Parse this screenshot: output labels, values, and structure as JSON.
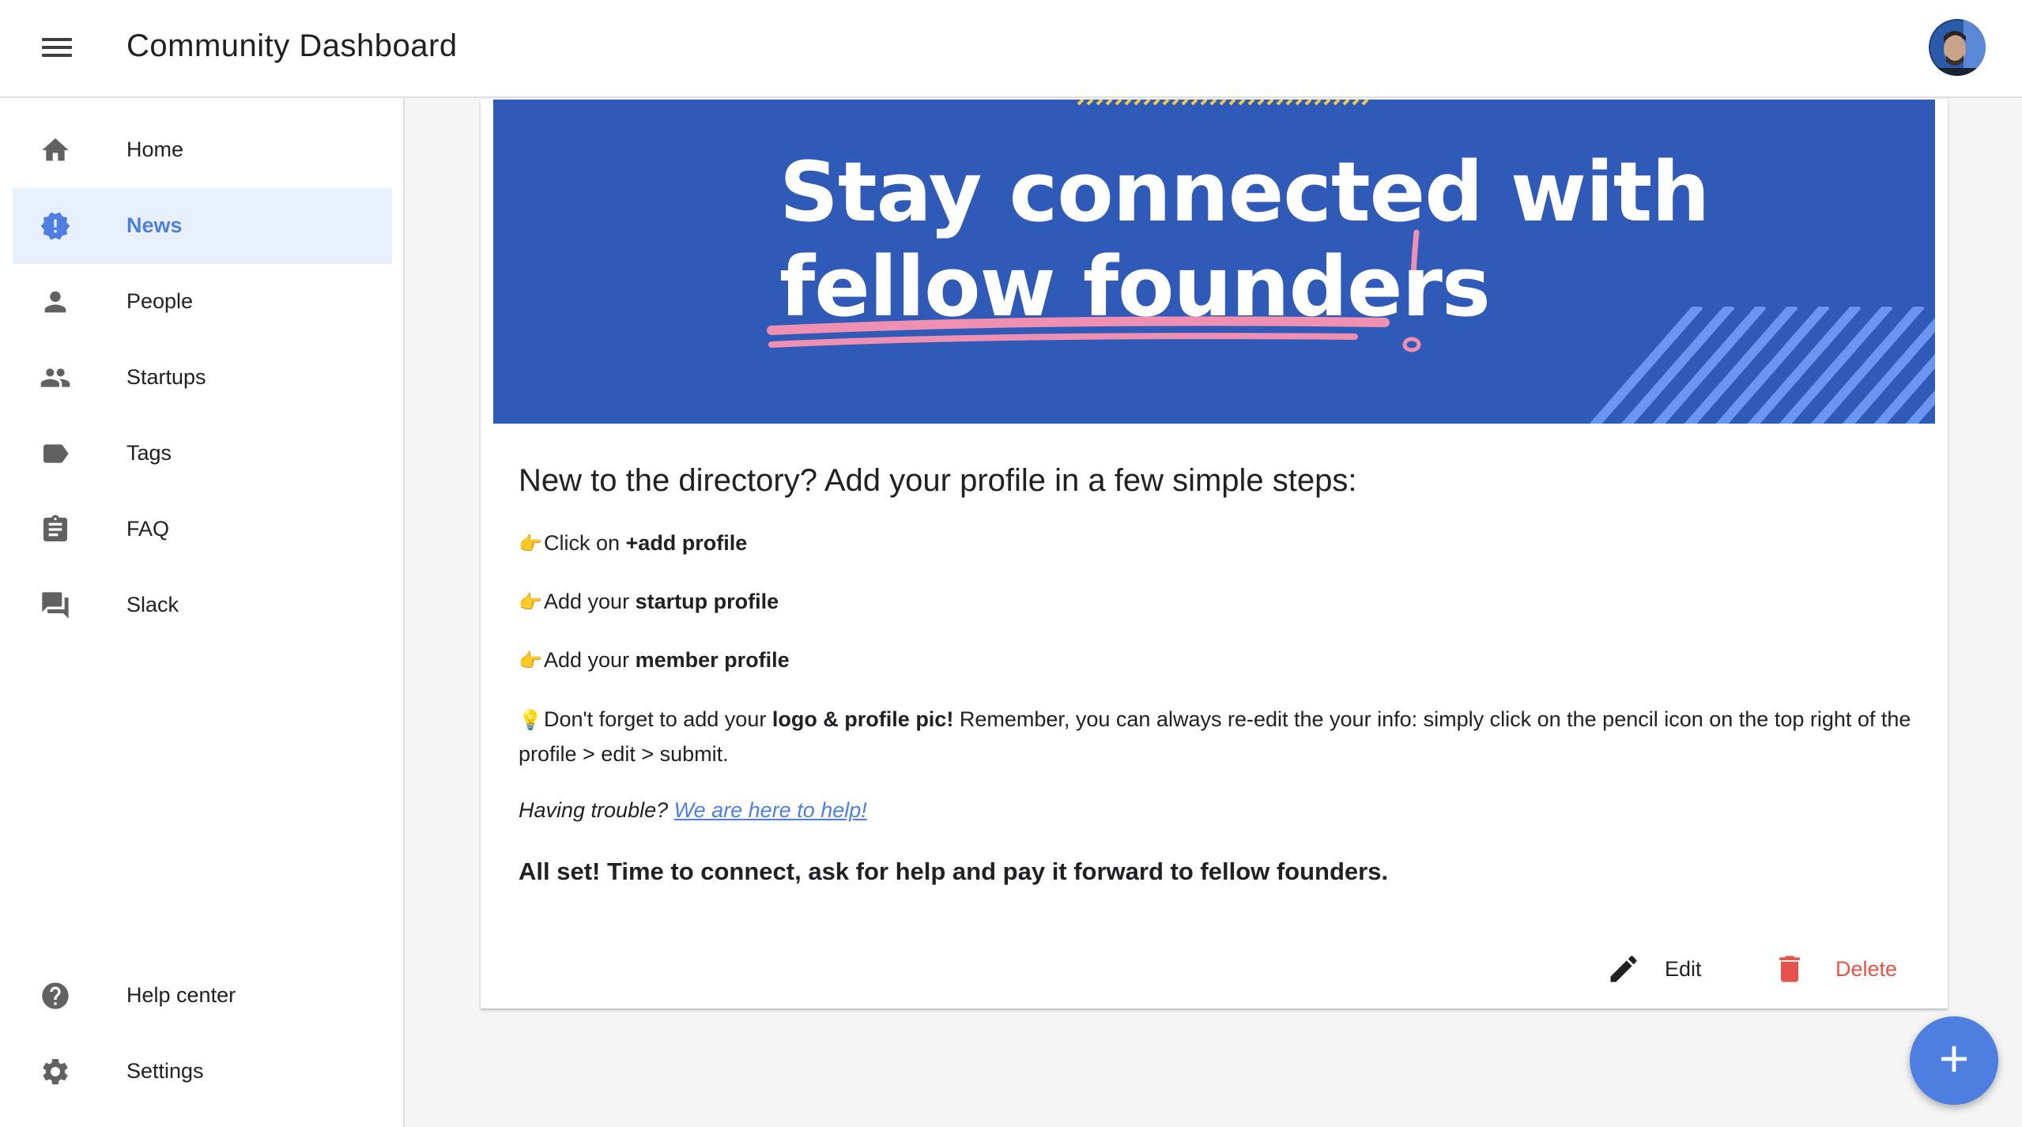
{
  "app": {
    "title": "Community Dashboard",
    "accent_color": "#4e7fe0",
    "danger_color": "#e5534b"
  },
  "sidebar": {
    "items": [
      {
        "label": "Home",
        "icon": "home-icon"
      },
      {
        "label": "News",
        "icon": "news-badge-icon",
        "active": true
      },
      {
        "label": "People",
        "icon": "person-icon"
      },
      {
        "label": "Startups",
        "icon": "group-icon"
      },
      {
        "label": "Tags",
        "icon": "label-icon"
      },
      {
        "label": "FAQ",
        "icon": "clipboard-icon"
      },
      {
        "label": "Slack",
        "icon": "chat-icon"
      }
    ],
    "footer_items": [
      {
        "label": "Help center",
        "icon": "help-icon"
      },
      {
        "label": "Settings",
        "icon": "gear-icon"
      }
    ]
  },
  "post": {
    "banner": {
      "line1": "Stay connected with",
      "line2": "fellow founders",
      "background": "#2f5ab8"
    },
    "heading": "New to the directory? Add your profile in a few simple steps:",
    "steps": [
      {
        "emoji": "👉",
        "prefix": "Click on ",
        "bold": "+add profile"
      },
      {
        "emoji": "👉",
        "prefix": "Add your ",
        "bold": "startup profile"
      },
      {
        "emoji": "👉",
        "prefix": "Add your ",
        "bold": "member profile"
      }
    ],
    "tip": {
      "emoji": "💡",
      "prefix": "Don't forget to add your ",
      "bold": "logo & profile pic!",
      "suffix": " Remember, you can always re-edit the your info: simply click on the pencil icon on the top right of the profile > edit > submit."
    },
    "trouble": {
      "text": "Having trouble? ",
      "link": "We are here to help!"
    },
    "closing": "All set! Time to connect, ask for help and pay it forward to fellow founders.",
    "actions": {
      "edit_label": "Edit",
      "delete_label": "Delete"
    }
  },
  "fab": {
    "label": "+"
  }
}
